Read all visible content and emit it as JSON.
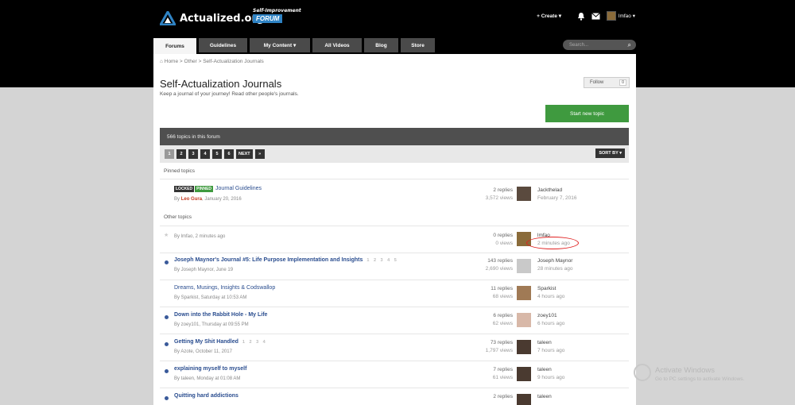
{
  "header": {
    "logo_text": "Actualized.org",
    "badge_sub": "Self-Improvement",
    "badge_main": "FORUM",
    "create_label": "Create",
    "username": "lmfao"
  },
  "nav": {
    "tabs": [
      {
        "label": "Forums"
      },
      {
        "label": "Guidelines"
      },
      {
        "label": "My Content ▾"
      },
      {
        "label": "All Videos"
      },
      {
        "label": "Blog"
      },
      {
        "label": "Store"
      }
    ],
    "search_placeholder": "Search..."
  },
  "breadcrumb": {
    "home": "Home",
    "sep": ">",
    "b1": "Other",
    "b2": "Self-Actualization Journals"
  },
  "forum": {
    "title": "Self-Actualization Journals",
    "description": "Keep a journal of your journey! Read other people's journals.",
    "follow_label": "Follow",
    "follow_count": "0",
    "start_label": "Start new topic",
    "topic_count": "566 topics in this forum",
    "sort_label": "SORT BY ▾"
  },
  "pagination": {
    "pages": [
      "1",
      "2",
      "3",
      "4",
      "5",
      "6"
    ],
    "next": "NEXT",
    "last": "»"
  },
  "sections": {
    "pinned": "Pinned topics",
    "other": "Other topics"
  },
  "pinned": {
    "tag_locked": "LOCKED",
    "tag_pinned": "PINNED",
    "title": "Journal Guidelines",
    "by": "By",
    "author": "Leo Gura",
    "date": ", January 20, 2016",
    "replies": "2 replies",
    "views": "3,572 views",
    "last_user": "Jackthelad",
    "last_time": "February 7, 2016"
  },
  "topics": [
    {
      "title": "",
      "meta": "By lmfao, 2 minutes ago",
      "replies": "0 replies",
      "views": "0 views",
      "last_user": "lmfao",
      "last_time": "2 minutes ago",
      "pages": ""
    },
    {
      "title": "Joseph Maynor's Journal #5: Life Purpose Implementation and Insights",
      "meta": "By Joseph Maynor, June 19",
      "replies": "143 replies",
      "views": "2,690 views",
      "last_user": "Joseph Maynor",
      "last_time": "28 minutes ago",
      "pages": "1 2 3 4 5"
    },
    {
      "title": "Dreams, Musings, Insights & Codswallop",
      "meta": "By Sparkist, Saturday at 10:53 AM",
      "replies": "11 replies",
      "views": "68 views",
      "last_user": "Sparkist",
      "last_time": "4 hours ago",
      "pages": ""
    },
    {
      "title": "Down into the Rabbit Hole - My Life",
      "meta": "By zoey101, Thursday at 09:55 PM",
      "replies": "6 replies",
      "views": "62 views",
      "last_user": "zoey101",
      "last_time": "6 hours ago",
      "pages": ""
    },
    {
      "title": "Getting My Shit Handled",
      "meta": "By Azote, October 11, 2017",
      "replies": "73 replies",
      "views": "1,797 views",
      "last_user": "taleen",
      "last_time": "7 hours ago",
      "pages": "1 2 3 4"
    },
    {
      "title": "explaining myself to myself",
      "meta": "By taleen, Monday at 01:08 AM",
      "replies": "7 replies",
      "views": "61 views",
      "last_user": "taleen",
      "last_time": "9 hours ago",
      "pages": ""
    },
    {
      "title": "Quitting hard addictions",
      "meta": "",
      "replies": "2 replies",
      "views": "",
      "last_user": "taleen",
      "last_time": "",
      "pages": ""
    }
  ],
  "watermark": {
    "title": "Activate Windows",
    "sub": "Go to PC settings to activate Windows."
  },
  "colors": {
    "accent_green": "#3f9a3f",
    "link_blue": "#2a4d8f",
    "annotation_red": "#e02020"
  }
}
